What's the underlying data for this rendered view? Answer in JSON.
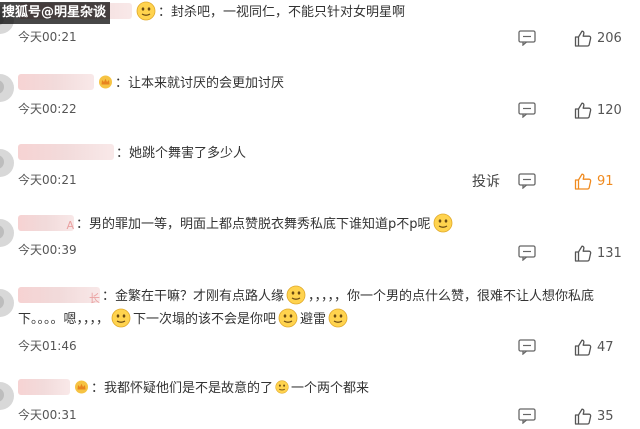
{
  "watermark": {
    "text": "搜狐号@明星杂谈"
  },
  "comments": [
    {
      "name_tail": "",
      "text": "：封杀吧，一视同仁，不能只针对女明星啊",
      "time": "今天00:21",
      "likes": "206"
    },
    {
      "name_tail": "",
      "text": "：让本来就讨厌的会更加讨厌",
      "time": "今天00:22",
      "likes": "120"
    },
    {
      "name_tail": "",
      "text": "：她跳个舞害了多少人",
      "time": "今天00:21",
      "likes": "91",
      "report": "投诉"
    },
    {
      "name_tail": "A",
      "text": "：男的罪加一等，明面上都点赞脱衣舞秀私底下谁知道p不p呢",
      "time": "今天00:39",
      "likes": "131"
    },
    {
      "name_tail": "长",
      "text_a": "：金繁在干嘛？才刚有点路人缘",
      "text_b": "，，，，，你一个男的点什么赞，很难不让人想你私底下。。。。嗯，，，，",
      "text_c": "下一次塌的该不会是你吧",
      "text_d": "避雷",
      "time": "今天01:46",
      "likes": "47"
    },
    {
      "name_tail": "",
      "text": "：我都怀疑他们是不是故意的了",
      "text_end": "一个两个都来",
      "time": "今天00:31",
      "likes": "35"
    }
  ],
  "colors": {
    "like_hot": "#f08a1e",
    "text": "#333333",
    "muted": "#555555"
  }
}
